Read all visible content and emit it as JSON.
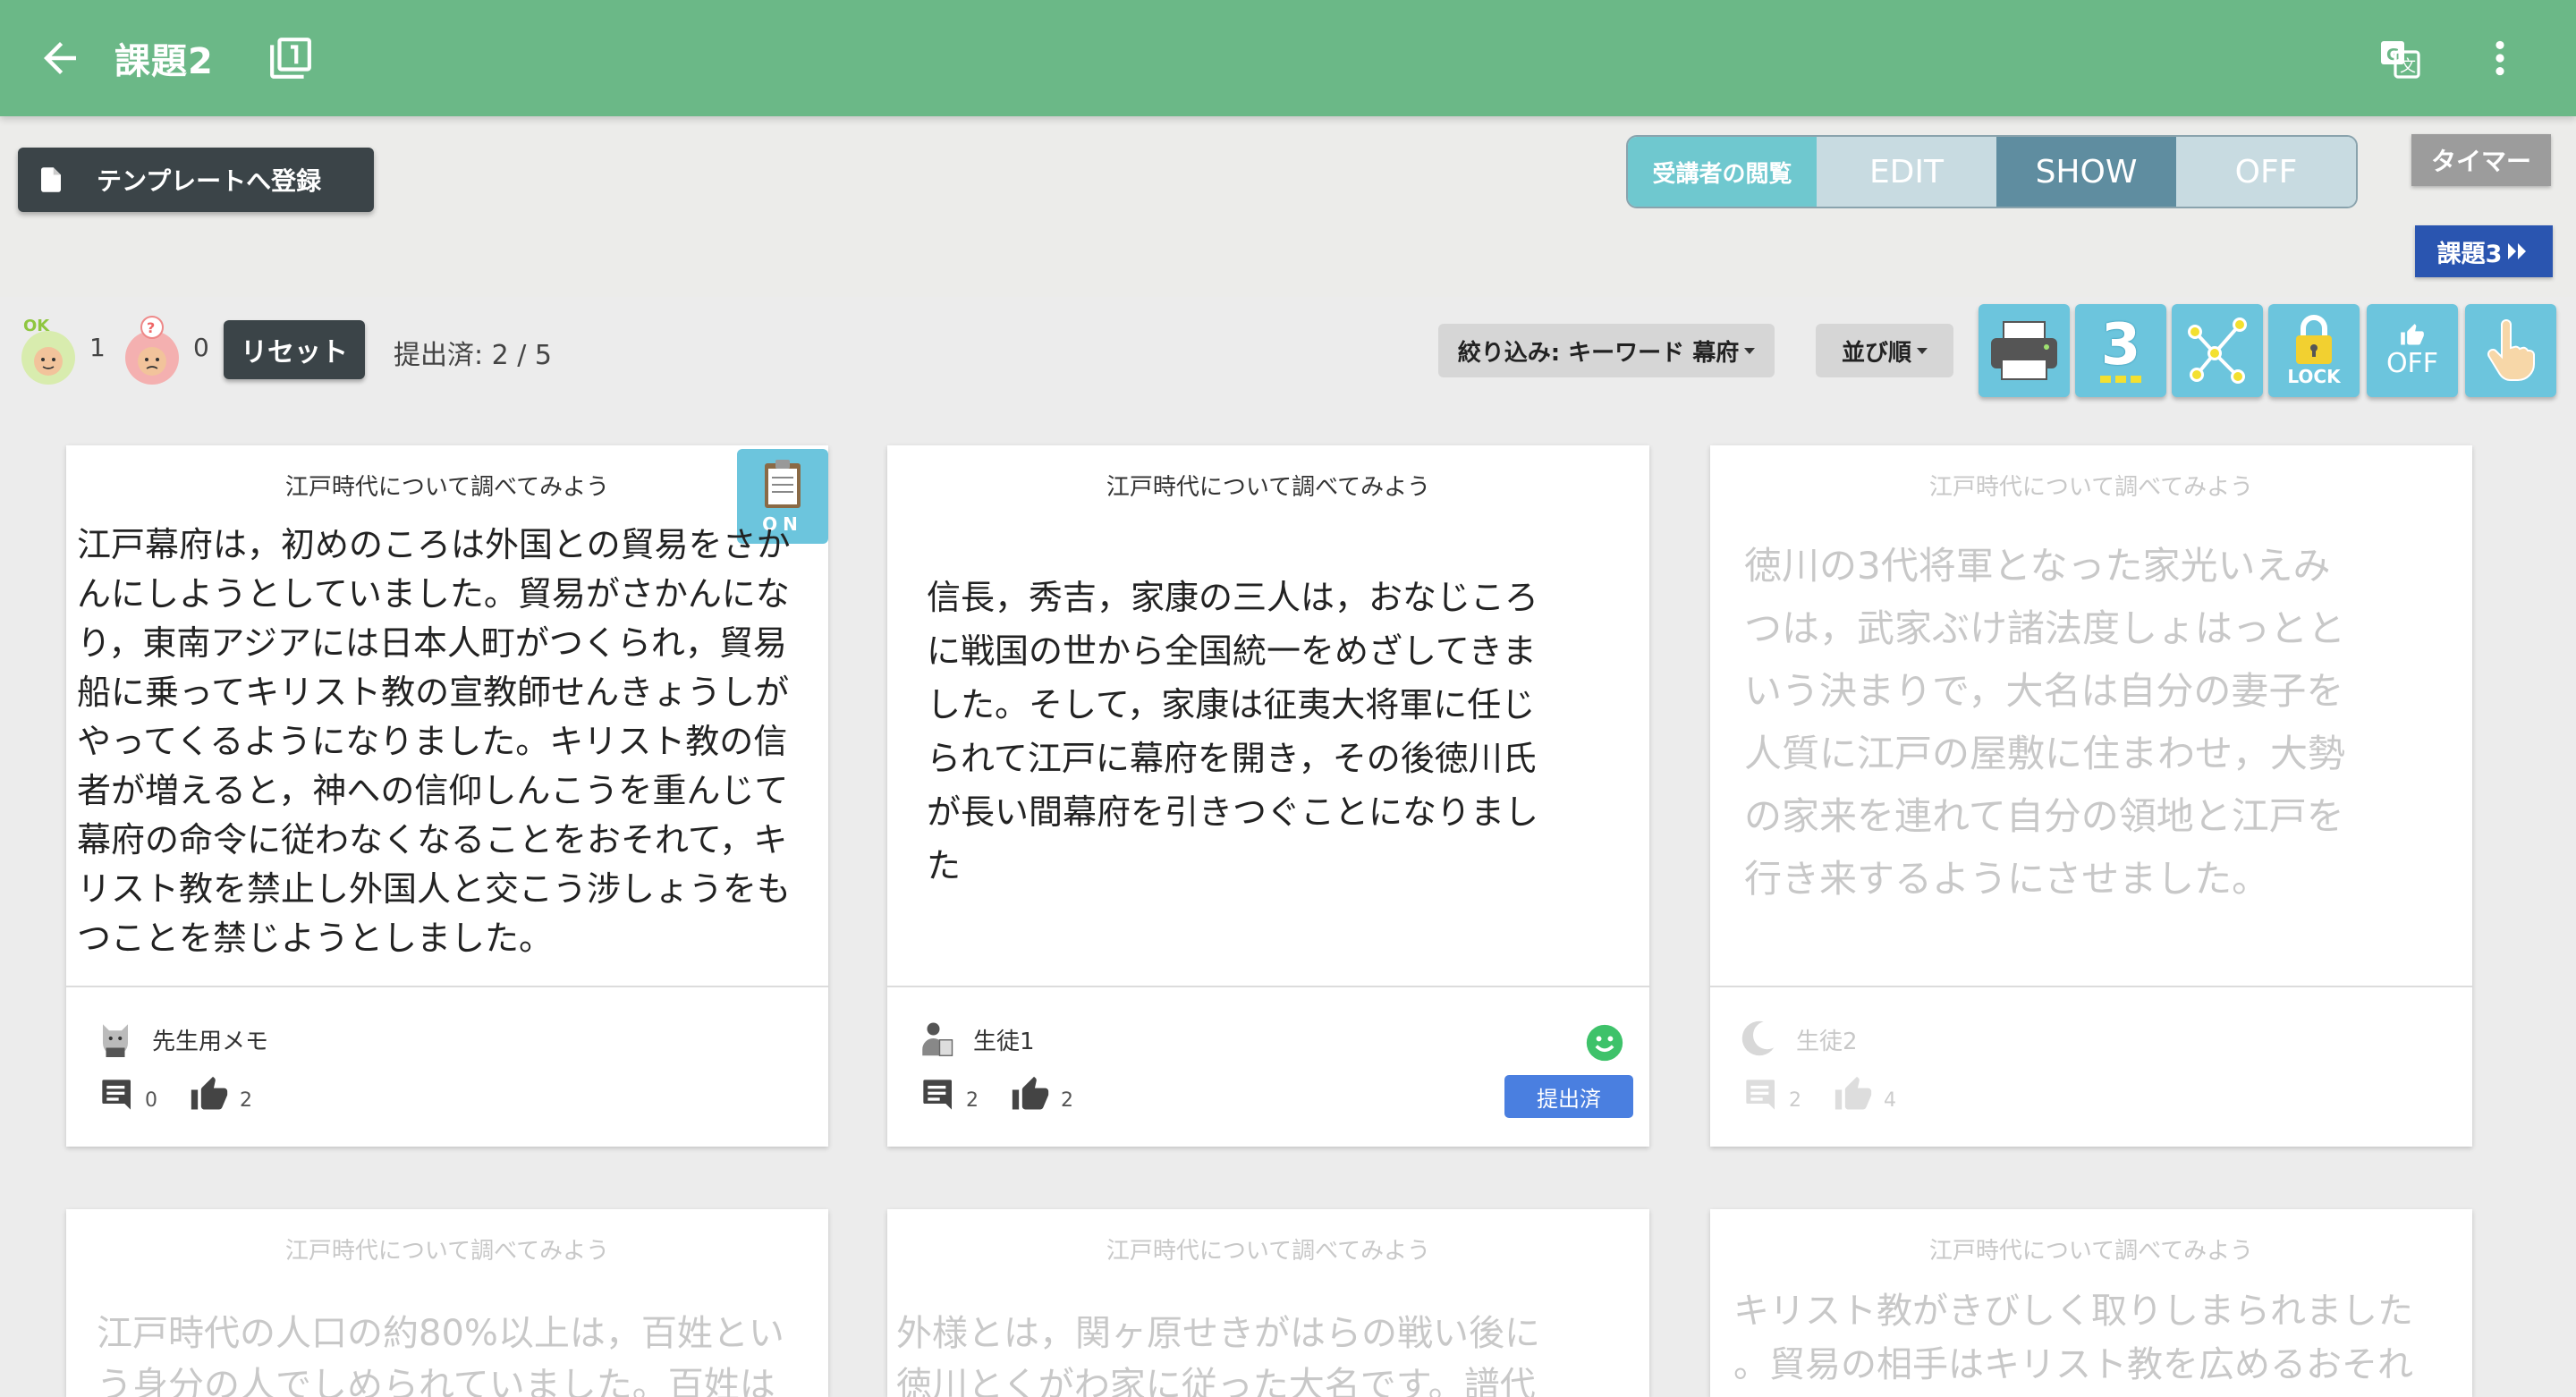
{
  "header": {
    "title": "課題2"
  },
  "toolbar": {
    "template_label": "テンプレートへ登録",
    "view_label": "受講者の閲覧",
    "view_options": [
      "EDIT",
      "SHOW",
      "OFF"
    ],
    "view_selected": "SHOW",
    "timer_label": "タイマー",
    "next_label": "課題3"
  },
  "status": {
    "ok_count": "1",
    "question_count": "0",
    "reset_label": "リセット",
    "submitted_text": "提出済: 2 / 5",
    "filter_label": "絞り込み: キーワード 幕府",
    "sort_label": "並び順"
  },
  "tools": {
    "number_label": "3",
    "lock_label": "LOCK",
    "like_toggle_label": "OFF"
  },
  "colors": {
    "header": "#6bb887",
    "accent_blue": "#6cc5dd",
    "dark_button": "#3b4448",
    "submitted_badge": "#4a7fe0"
  },
  "cards": [
    {
      "title": "江戸時代について調べてみよう",
      "body_lines": [
        "江戸幕府は，初めのころは外国との貿易をさか",
        "んにしようとしていました。貿易がさかんにな",
        "り，東南アジアには日本人町がつくられ，貿易",
        "船に乗ってキリスト教の宣教師せんきょうしが",
        "やってくるようになりました。キリスト教の信",
        "者が増えると，神への信仰しんこうを重んじて",
        "幕府の命令に従わなくなることをおそれて，キ",
        "リスト教を禁止し外国人と交こう涉しょうをも",
        "つことを禁じようとしました。"
      ],
      "author": "先生用メモ",
      "comments": "0",
      "likes": "2",
      "badge": "ON"
    },
    {
      "title": "江戸時代について調べてみよう",
      "body_lines": [
        "信長，秀吉，家康の三人は，おなじころ",
        "に戦国の世から全国統一をめざしてきま",
        "した。そして，家康は征夷大将軍に任じ",
        "られて江戸に幕府を開き，その後徳川氏",
        "が長い間幕府を引きつぐことになりまし",
        "た"
      ],
      "author": "生徒1",
      "comments": "2",
      "likes": "2",
      "status": "提出済"
    },
    {
      "title": "江戸時代について調べてみよう",
      "body_lines": [
        "徳川の3代将軍となった家光いえみ",
        "つは，武家ぶけ諸法度しょはっとと",
        "いう決まりで，大名は自分の妻子を",
        "人質に江戸の屋敷に住まわせ，大勢",
        "の家来を連れて自分の領地と江戸を",
        "行き来するようにさせました。"
      ],
      "author": "生徒2",
      "comments": "2",
      "likes": "4"
    },
    {
      "title": "江戸時代について調べてみよう",
      "body_lines": [
        "江戸時代の人口の約80%以上は，百姓とい",
        "う身分の人でしめられていました。百姓は"
      ]
    },
    {
      "title": "江戸時代について調べてみよう",
      "body_lines": [
        "外様とは，関ヶ原せきがはらの戦い後に",
        "徳川とくがわ家に従った大名です。譜代"
      ]
    },
    {
      "title": "江戸時代について調べてみよう",
      "body_lines": [
        "キリスト教がきびしく取りしまられました",
        "。貿易の相手はキリスト教を広めるおそれ"
      ]
    }
  ]
}
